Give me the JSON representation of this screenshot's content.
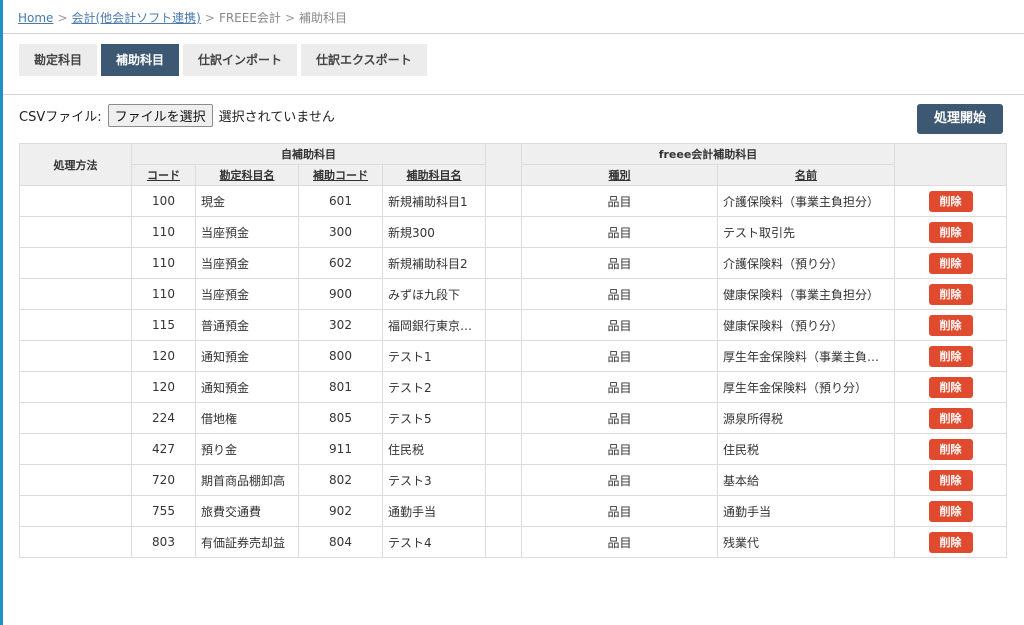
{
  "breadcrumb": {
    "home": "Home",
    "accounting": "会計(他会計ソフト連携)",
    "freee": "FREEE会計",
    "current": "補助科目",
    "sep": ">"
  },
  "tabs": [
    {
      "label": "勘定科目",
      "active": false
    },
    {
      "label": "補助科目",
      "active": true
    },
    {
      "label": "仕訳インポート",
      "active": false
    },
    {
      "label": "仕訳エクスポート",
      "active": false
    }
  ],
  "csv": {
    "label": "CSVファイル:",
    "button": "ファイルを選択",
    "status": "選択されていません"
  },
  "start_button": "処理開始",
  "table": {
    "group_left": "自補助科目",
    "group_right": "freee会計補助科目",
    "col_method": "処理方法",
    "col_code": "コード",
    "col_account": "勘定科目名",
    "col_sub_code": "補助コード",
    "col_sub_name": "補助科目名",
    "col_type": "種別",
    "col_name": "名前",
    "delete_label": "削除",
    "rows": [
      {
        "code": "100",
        "account": "現金",
        "sub_code": "601",
        "sub_name": "新規補助科目1",
        "type": "品目",
        "name": "介護保険料（事業主負担分）"
      },
      {
        "code": "110",
        "account": "当座預金",
        "sub_code": "300",
        "sub_name": "新規300",
        "type": "品目",
        "name": "テスト取引先"
      },
      {
        "code": "110",
        "account": "当座預金",
        "sub_code": "602",
        "sub_name": "新規補助科目2",
        "type": "品目",
        "name": "介護保険料（預り分）"
      },
      {
        "code": "110",
        "account": "当座預金",
        "sub_code": "900",
        "sub_name": "みずほ九段下",
        "type": "品目",
        "name": "健康保険料（事業主負担分）"
      },
      {
        "code": "115",
        "account": "普通預金",
        "sub_code": "302",
        "sub_name": "福岡銀行東京支店",
        "type": "品目",
        "name": "健康保険料（預り分）"
      },
      {
        "code": "120",
        "account": "通知預金",
        "sub_code": "800",
        "sub_name": "テスト1",
        "type": "品目",
        "name": "厚生年金保険料（事業主負担分）"
      },
      {
        "code": "120",
        "account": "通知預金",
        "sub_code": "801",
        "sub_name": "テスト2",
        "type": "品目",
        "name": "厚生年金保険料（預り分）"
      },
      {
        "code": "224",
        "account": "借地権",
        "sub_code": "805",
        "sub_name": "テスト5",
        "type": "品目",
        "name": "源泉所得税"
      },
      {
        "code": "427",
        "account": "預り金",
        "sub_code": "911",
        "sub_name": "住民税",
        "type": "品目",
        "name": "住民税"
      },
      {
        "code": "720",
        "account": "期首商品棚卸高",
        "sub_code": "802",
        "sub_name": "テスト3",
        "type": "品目",
        "name": "基本給"
      },
      {
        "code": "755",
        "account": "旅費交通費",
        "sub_code": "902",
        "sub_name": "通勤手当",
        "type": "品目",
        "name": "通勤手当"
      },
      {
        "code": "803",
        "account": "有価証券売却益",
        "sub_code": "804",
        "sub_name": "テスト4",
        "type": "品目",
        "name": "残業代"
      }
    ]
  }
}
